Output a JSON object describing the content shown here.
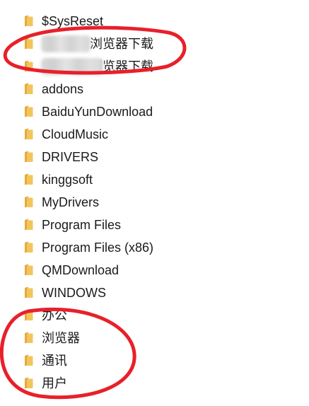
{
  "folders": [
    {
      "label": "$SysReset"
    },
    {
      "label": "浏览器下载",
      "masked": true
    },
    {
      "label": "浏览器下载",
      "masked": true
    },
    {
      "label": "addons"
    },
    {
      "label": "BaiduYunDownload"
    },
    {
      "label": "CloudMusic"
    },
    {
      "label": "DRIVERS"
    },
    {
      "label": "kinggsoft"
    },
    {
      "label": "MyDrivers"
    },
    {
      "label": "Program Files"
    },
    {
      "label": "Program Files (x86)"
    },
    {
      "label": "QMDownload"
    },
    {
      "label": "WINDOWS"
    },
    {
      "label": "办公"
    },
    {
      "label": "浏览器"
    },
    {
      "label": "通讯"
    },
    {
      "label": "用户"
    }
  ],
  "colors": {
    "folder_body": "#f2c55c",
    "folder_tab": "#e6a93a",
    "annotation": "#e8202a"
  },
  "icons": {
    "folder": "folder-icon"
  }
}
